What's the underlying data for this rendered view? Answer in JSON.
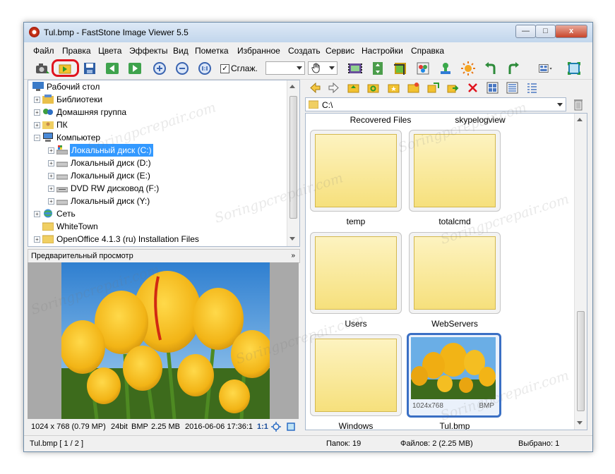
{
  "window": {
    "title": "Tul.bmp  -  FastStone Image Viewer 5.5",
    "minimize": "—",
    "maximize": "□",
    "close": "x"
  },
  "menu": [
    "Файл",
    "Правка",
    "Цвета",
    "Эффекты",
    "Вид",
    "Пометка",
    "Избранное",
    "Создать",
    "Сервис",
    "Настройки",
    "Справка"
  ],
  "toolbar": {
    "smooth_label": "Сглаж.",
    "smooth_checked": true,
    "zoom_value": ""
  },
  "tree": {
    "items": [
      {
        "label": "Рабочий стол"
      },
      {
        "label": "Библиотеки"
      },
      {
        "label": "Домашняя группа"
      },
      {
        "label": "ПК"
      },
      {
        "label": "Компьютер"
      },
      {
        "label": "Локальный диск (C:)"
      },
      {
        "label": "Локальный диск (D:)"
      },
      {
        "label": "Локальный диск (E:)"
      },
      {
        "label": "DVD RW дисковод (F:)"
      },
      {
        "label": "Локальный диск (Y:)"
      },
      {
        "label": "Сеть"
      },
      {
        "label": "WhiteTown"
      },
      {
        "label": "OpenOffice 4.1.3 (ru) Installation Files"
      }
    ]
  },
  "preview": {
    "header": "Предварительный просмотр",
    "info": {
      "dimensions": "1024 x 768 (0.79 MP)",
      "depth": "24bit",
      "format": "BMP",
      "size": "2.25 MB",
      "datetime": "2016-06-06 17:36:1",
      "ratio": "1:1"
    }
  },
  "browser": {
    "path": "C:\\",
    "top_labels": [
      "Recovered Files",
      "skypelogview"
    ],
    "cards": [
      {
        "label": "temp"
      },
      {
        "label": "totalcmd"
      },
      {
        "label": "Users"
      },
      {
        "label": "WebServers"
      },
      {
        "label": "Windows"
      },
      {
        "label": "Tul.bmp",
        "dims": "1024x768",
        "format": "BMP",
        "selected": true
      }
    ]
  },
  "statusbar": {
    "file": "Tul.bmp [ 1 / 2 ]",
    "folders": "Папок: 19",
    "files": "Файлов: 2 (2.25 MB)",
    "selected": "Выбрано: 1"
  },
  "watermark": "Soringpcrepair.com",
  "colors": {
    "selection": "#3399ff",
    "selected_border": "#3a6fc4",
    "highlight_ring": "#e0141e",
    "folder": "#f6e07c"
  }
}
